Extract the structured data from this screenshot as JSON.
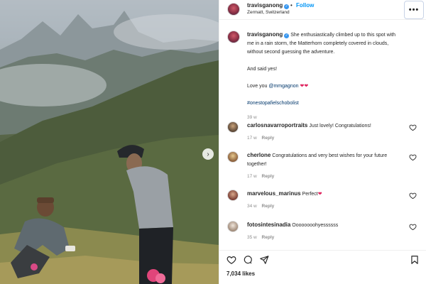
{
  "post": {
    "author": {
      "username": "travisganong",
      "location": "Zermatt, Switzerland",
      "follow_label": "Follow",
      "separator": "•"
    },
    "more_label": "•••",
    "caption": {
      "text": "She enthusiastically climbed up to this spot with me in a rain storm, the Matterhorn completely covered in clouds, without second guessing the adventure.",
      "line2": "And said yes!",
      "line3_prefix": "Love you",
      "line3_mention": "@mmgagnon",
      "line3_hearts": "❤❤",
      "hashtag": "#onestopafielschobolist",
      "age": "39 w"
    },
    "comments": [
      {
        "username": "carlosnavarroportraits",
        "text": "Just lovely! Congratulations!",
        "age": "17 w",
        "reply_label": "Reply"
      },
      {
        "username": "cherlone",
        "text": "Congratulations and very best wishes for your future together!",
        "age": "17 w",
        "reply_label": "Reply"
      },
      {
        "username": "marvelous_marinus",
        "text": "Perfect",
        "heart": "❤",
        "age": "34 w",
        "reply_label": "Reply"
      },
      {
        "username": "fotosintesinadia",
        "text": "Oooooooohyessssss",
        "age": "35 w",
        "reply_label": "Reply"
      }
    ],
    "likes": "7,034 likes"
  },
  "colors": {
    "link_blue": "#0095f6",
    "verified_blue": "#3897f0",
    "heart_red": "#e0245e",
    "muted": "#8e8e8e"
  },
  "icons": {
    "header_more": "more-horizontal-icon",
    "verified": "verified-badge-icon",
    "like": "heart-outline-icon",
    "comment": "comment-bubble-icon",
    "share": "paper-plane-icon",
    "save": "bookmark-icon",
    "carousel": "chevron-right-icon"
  }
}
